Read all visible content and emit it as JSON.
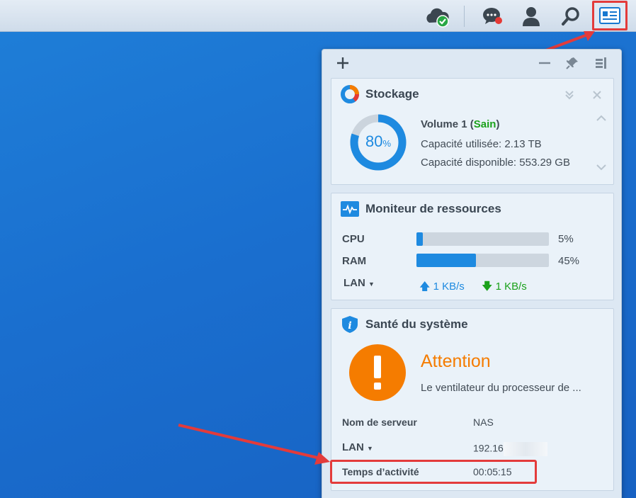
{
  "taskbar": {
    "icons": [
      "cloud-sync-icon",
      "notifications-icon",
      "user-icon",
      "search-icon",
      "widgets-icon"
    ]
  },
  "panel": {
    "tools": [
      "add-icon",
      "minimize-icon",
      "pin-icon",
      "dock-icon"
    ],
    "storage": {
      "title": "Stockage",
      "percent": "80",
      "percent_unit": "%",
      "usage_fraction": 0.8,
      "volume_prefix": "Volume 1 (",
      "volume_status": "Sain",
      "volume_suffix": ")",
      "used": "Capacité utilisée: 2.13 TB",
      "available": "Capacité disponible: 553.29 GB"
    },
    "resources": {
      "title": "Moniteur de ressources",
      "cpu_label": "CPU",
      "cpu_value": "5%",
      "cpu_fraction": 0.05,
      "ram_label": "RAM",
      "ram_value": "45%",
      "ram_fraction": 0.45,
      "lan_label": "LAN",
      "upload": "1 KB/s",
      "download": "1 KB/s"
    },
    "health": {
      "title": "Santé du système",
      "status": "Attention",
      "message": "Le ventilateur du processeur de ...",
      "server_label": "Nom de serveur",
      "server_value": "NAS",
      "lan_label": "LAN",
      "lan_value": "192.16",
      "uptime_label": "Temps d’activité",
      "uptime_value": "00:05:15"
    }
  },
  "colors": {
    "accent": "#1e8ae0",
    "healthy": "#1ba11b",
    "warning": "#f57c00",
    "annotation": "#e33b3b"
  }
}
